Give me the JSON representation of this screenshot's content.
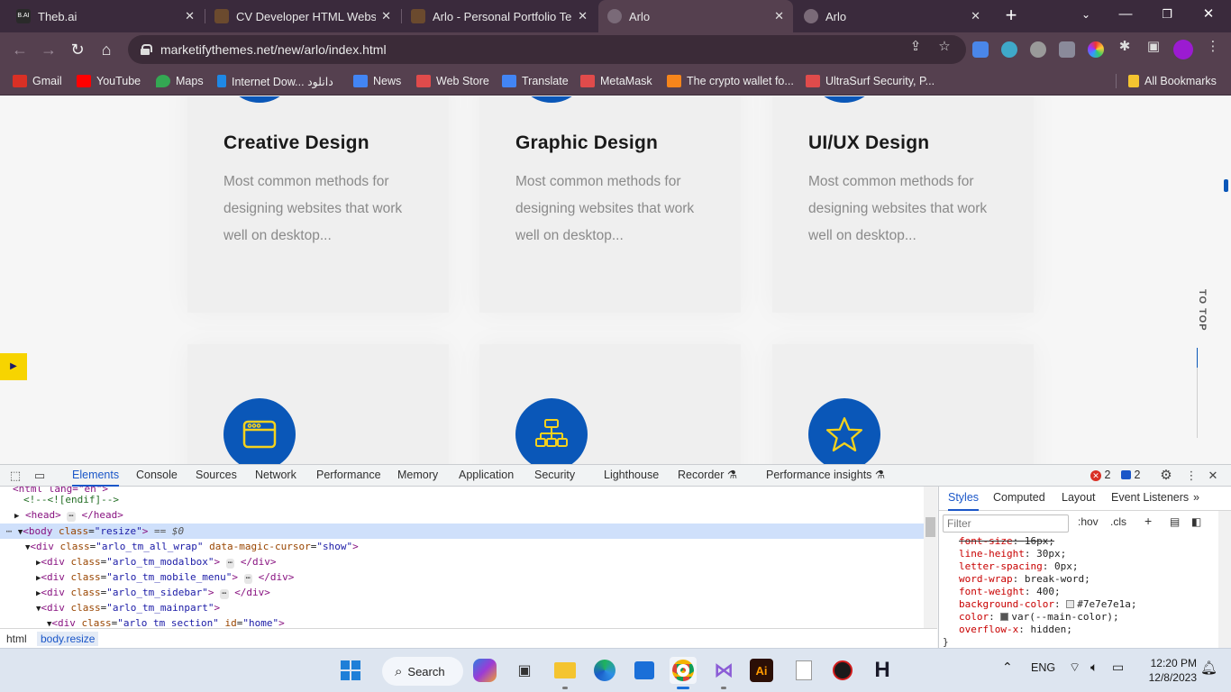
{
  "browser": {
    "tabs": [
      {
        "title": "Theb.ai",
        "active": false,
        "favicon_color": "#333333"
      },
      {
        "title": "CV Developer HTML Website",
        "active": false,
        "favicon_color": "#6b4a2e"
      },
      {
        "title": "Arlo - Personal Portfolio Tem",
        "active": false,
        "favicon_color": "#6b4a2e"
      },
      {
        "title": "Arlo",
        "active": true,
        "favicon_color": "#7a6a78"
      },
      {
        "title": "Arlo",
        "active": false,
        "favicon_color": "#7a6a78"
      }
    ],
    "url": "marketifythemes.net/new/arlo/index.html",
    "bookmarks": [
      {
        "label": "Gmail",
        "color": "#d93025"
      },
      {
        "label": "YouTube",
        "color": "#ff0000"
      },
      {
        "label": "Maps",
        "color": "#34a853"
      },
      {
        "label": "Internet Dow... دانلود",
        "color": "#1e88e5"
      },
      {
        "label": "News",
        "color": "#4285f4"
      },
      {
        "label": "Web Store",
        "color": "#e04b4b"
      },
      {
        "label": "Translate",
        "color": "#4285f4"
      },
      {
        "label": "MetaMask",
        "color": "#e04b4b"
      },
      {
        "label": "The crypto wallet fo...",
        "color": "#f6851b"
      },
      {
        "label": "UltraSurf Security, P...",
        "color": "#e04b4b"
      }
    ],
    "all_bookmarks": "All Bookmarks"
  },
  "page": {
    "accent_color": "#0a57b8",
    "cards_row1": [
      {
        "title": "Creative Design",
        "text": "Most common methods for designing websites that work well on desktop..."
      },
      {
        "title": "Graphic Design",
        "text": "Most common methods for designing websites that work well on desktop..."
      },
      {
        "title": "UI/UX Design",
        "text": "Most common methods for designing websites that work well on desktop..."
      }
    ],
    "cards_row2_icons": [
      "browser-window-icon",
      "sitemap-icon",
      "star-icon"
    ],
    "to_top": "TO TOP"
  },
  "devtools": {
    "tabs": [
      "Elements",
      "Console",
      "Sources",
      "Network",
      "Performance",
      "Memory",
      "Application",
      "Security",
      "Lighthouse",
      "Recorder",
      "Performance insights"
    ],
    "active_tab": "Elements",
    "errors": "2",
    "messages": "2",
    "dom": [
      "<!--<![endif]-->",
      "<head>",
      "<body class=\"resize\"> == $0",
      "<div class=\"arlo_tm_all_wrap\" data-magic-cursor=\"show\">",
      "<div class=\"arlo_tm_modalbox\">",
      "<div class=\"arlo_tm_mobile_menu\">",
      "<div class=\"arlo_tm_sidebar\">",
      "<div class=\"arlo_tm_mainpart\">",
      "<div class=\"arlo_tm_section\" id=\"home\">"
    ],
    "breadcrumbs": [
      "html",
      "body.resize"
    ],
    "styles_tabs": [
      "Styles",
      "Computed",
      "Layout",
      "Event Listeners"
    ],
    "filter_placeholder": "Filter",
    "hov": ":hov",
    "cls": ".cls",
    "css_rules": [
      {
        "prop": "font-size",
        "value": "16px;",
        "struck": true
      },
      {
        "prop": "line-height",
        "value": "30px;"
      },
      {
        "prop": "letter-spacing",
        "value": "0px;"
      },
      {
        "prop": "word-wrap",
        "value": "break-word;"
      },
      {
        "prop": "font-weight",
        "value": "400;"
      },
      {
        "prop": "background-color",
        "value": "#7e7e7e1a;",
        "swatch": "#e8e8e8"
      },
      {
        "prop": "color",
        "value": "var(--main-color);",
        "swatch": "#555555"
      },
      {
        "prop": "overflow-x",
        "value": "hidden;"
      }
    ],
    "closing_brace": "}"
  },
  "taskbar": {
    "search_label": "Search",
    "language": "ENG",
    "time": "12:20 PM",
    "date": "12/8/2023"
  }
}
